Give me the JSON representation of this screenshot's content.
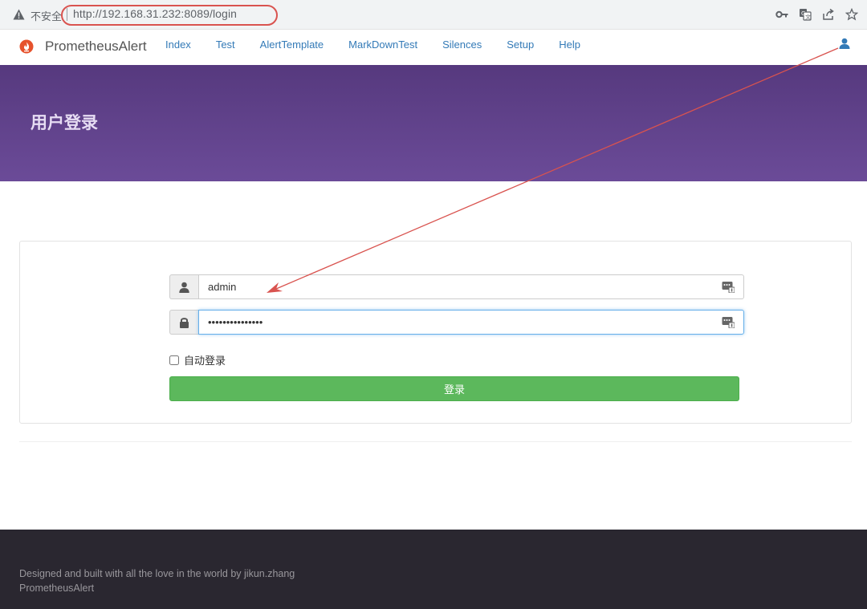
{
  "browser": {
    "security_label": "不安全",
    "url": "http://192.168.31.232:8089/login",
    "icons": [
      "warning-icon",
      "key-icon",
      "translate-icon",
      "share-icon",
      "star-icon"
    ]
  },
  "navbar": {
    "brand": "PrometheusAlert",
    "links": [
      {
        "label": "Index"
      },
      {
        "label": "Test"
      },
      {
        "label": "AlertTemplate"
      },
      {
        "label": "MarkDownTest"
      },
      {
        "label": "Silences"
      },
      {
        "label": "Setup"
      },
      {
        "label": "Help"
      }
    ],
    "link_color": "#337ab7"
  },
  "hero": {
    "title": "用户登录",
    "gradient": [
      "#56397e",
      "#6b4b98"
    ]
  },
  "login": {
    "username_value": "admin",
    "password_value": "•••••••••••••••",
    "remember_label": "自动登录",
    "remember_checked": false,
    "submit_label": "登录",
    "button_color": "#5cb85c"
  },
  "footer": {
    "line1": "Designed and built with all the love in the world by jikun.zhang",
    "line2": "PrometheusAlert"
  },
  "colors": {
    "annotation": "#d9534f",
    "footer_bg": "#2a2730"
  }
}
